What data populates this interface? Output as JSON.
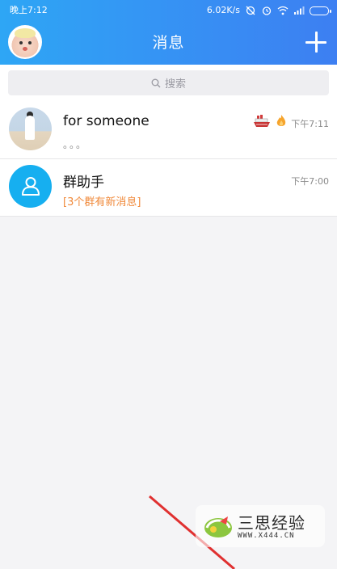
{
  "status_bar": {
    "time": "晚上7:12",
    "network_speed": "6.02K/s"
  },
  "header": {
    "title": "消息"
  },
  "search": {
    "placeholder": "搜索"
  },
  "conversations": [
    {
      "name": "for  someone",
      "preview": "。。。",
      "time": "下午7:11",
      "badges": [
        "ship-icon",
        "flame-icon"
      ]
    },
    {
      "name": "群助手",
      "preview": "[3个群有新消息]",
      "time": "下午7:00"
    }
  ],
  "watermark": {
    "title": "三思经验",
    "url": "WWW.X444.CN"
  },
  "colors": {
    "header_start": "#2ea6f5",
    "header_end": "#3d7ff2",
    "notice_orange": "#f0893a",
    "group_avatar_blue": "#16aff0"
  }
}
